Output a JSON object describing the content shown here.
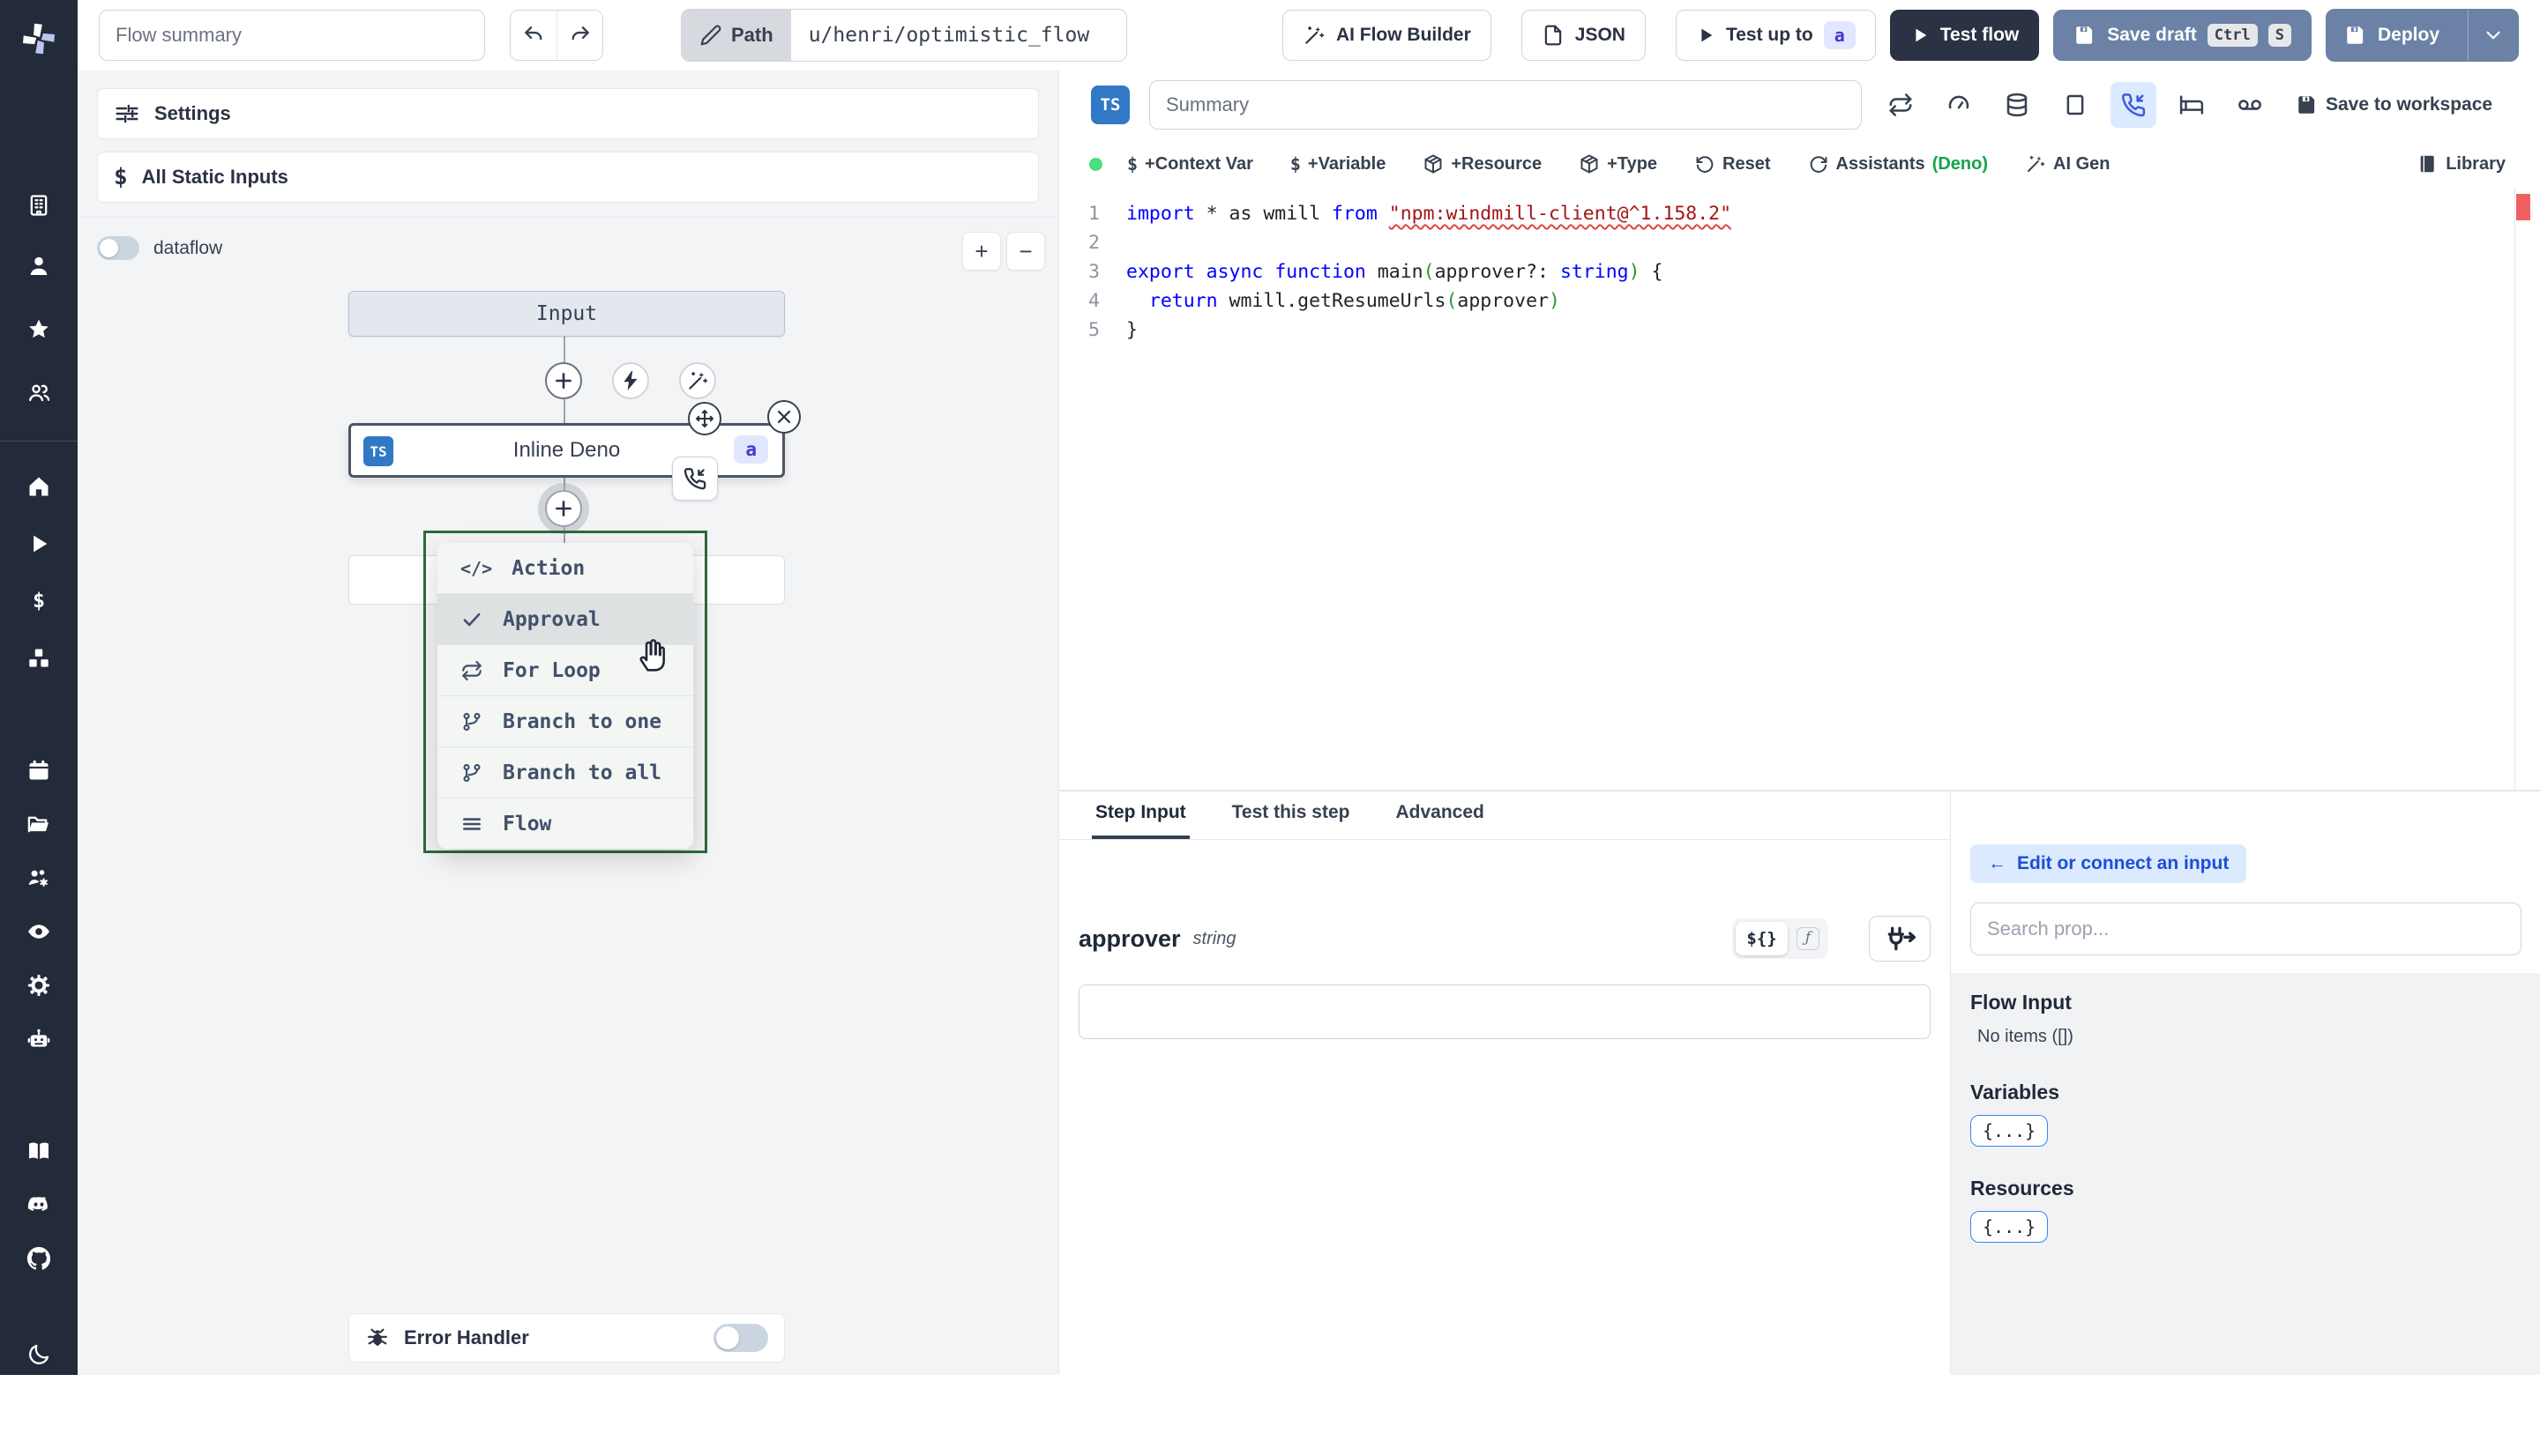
{
  "topbar": {
    "flow_summary_placeholder": "Flow summary",
    "path": {
      "label": "Path",
      "value": "u/henri/optimistic_flow"
    },
    "ai_flow_builder": "AI Flow Builder",
    "json": "JSON",
    "test_up_to": "Test up to",
    "test_up_to_badge": "a",
    "test_flow": "Test flow",
    "save_draft": "Save draft",
    "kbd_ctrl": "Ctrl",
    "kbd_s": "S",
    "deploy": "Deploy"
  },
  "sidebar": {
    "icons": [
      "windmill-logo",
      "building-icon",
      "user-icon",
      "star-icon",
      "user-group-icon",
      "home-icon",
      "play-icon",
      "dollar-icon",
      "boxes-icon",
      "calendar-icon",
      "folder-open-icon",
      "users-cog-icon",
      "eye-icon",
      "gear-icon",
      "robot-icon",
      "book-open-icon",
      "discord-icon",
      "github-icon",
      "moon-icon",
      "arrow-right-icon"
    ]
  },
  "flow_panel": {
    "settings": "Settings",
    "all_static_inputs": "All Static Inputs",
    "dataflow": "dataflow",
    "zoom_in": "+",
    "zoom_out": "−",
    "input_node": "Input",
    "step_node": {
      "badge": "TS",
      "label": "Inline Deno",
      "id_badge": "a"
    },
    "insert_menu": {
      "items": [
        {
          "icon": "code-icon",
          "label": "Action"
        },
        {
          "icon": "check-icon",
          "label": "Approval"
        },
        {
          "icon": "repeat-icon",
          "label": "For Loop"
        },
        {
          "icon": "git-branch-icon",
          "label": "Branch to one"
        },
        {
          "icon": "git-branch-icon",
          "label": "Branch to all"
        },
        {
          "icon": "menu-lines-icon",
          "label": "Flow"
        }
      ]
    },
    "error_handler": "Error Handler"
  },
  "editor": {
    "lang_badge": "TS",
    "summary_placeholder": "Summary",
    "actions": {
      "context_var": "+Context Var",
      "variable": "+Variable",
      "resource": "+Resource",
      "type": "+Type",
      "reset": "Reset",
      "assistants": "Assistants",
      "assistants_lang": "(Deno)",
      "ai_gen": "AI Gen",
      "library": "Library",
      "save_to_workspace": "Save to workspace"
    },
    "code_lines": [
      {
        "no": "1",
        "tokens": [
          [
            "kw",
            "import"
          ],
          [
            "pl",
            " * as wmill "
          ],
          [
            "kw",
            "from"
          ],
          [
            "pl",
            " "
          ],
          [
            "str",
            "\"npm:windmill-client@^1.158.2\""
          ]
        ]
      },
      {
        "no": "2",
        "tokens": []
      },
      {
        "no": "3",
        "tokens": [
          [
            "kw",
            "export"
          ],
          [
            "pl",
            " "
          ],
          [
            "kw",
            "async"
          ],
          [
            "pl",
            " "
          ],
          [
            "kw",
            "function"
          ],
          [
            "pl",
            " main"
          ],
          [
            "pr",
            "("
          ],
          [
            "pl",
            "approver?: "
          ],
          [
            "kw",
            "string"
          ],
          [
            "pr",
            ")"
          ],
          [
            "pl",
            " {"
          ]
        ]
      },
      {
        "no": "4",
        "tokens": [
          [
            "pl",
            "  "
          ],
          [
            "kw",
            "return"
          ],
          [
            "pl",
            " wmill.getResumeUrls"
          ],
          [
            "pr2",
            "("
          ],
          [
            "pl",
            "approver"
          ],
          [
            "pr2",
            ")"
          ]
        ]
      },
      {
        "no": "5",
        "tokens": [
          [
            "pl",
            "}"
          ]
        ]
      }
    ]
  },
  "step_panel": {
    "tabs": [
      {
        "label": "Step Input"
      },
      {
        "label": "Test this step"
      },
      {
        "label": "Advanced"
      }
    ],
    "field": {
      "name": "approver",
      "type": "string"
    },
    "expr_toggle": "${}",
    "fn_toggle": "ƒ",
    "input_value": ""
  },
  "connect_panel": {
    "back_arrow": "←",
    "back_label": "Edit or connect an input",
    "search_placeholder": "Search prop...",
    "flow_input_title": "Flow Input",
    "flow_input_empty": "No items ([])",
    "variables_title": "Variables",
    "variables_button": "{...}",
    "resources_title": "Resources",
    "resources_button": "{...}"
  },
  "colors": {
    "sidebar_bg": "#232a39",
    "primary_slate": "#6b82a6",
    "dark_button": "#2b3244",
    "ts_badge_blue": "#3178c6",
    "badge_indigo_bg": "#e0e7ff",
    "badge_indigo_text": "#4338ca",
    "menu_border_green": "#2e6b3c",
    "status_green": "#4ade80",
    "deno_green": "#16a34a",
    "error_marker_red": "#ef4444",
    "active_icon_blue": "#3b5bdb"
  }
}
